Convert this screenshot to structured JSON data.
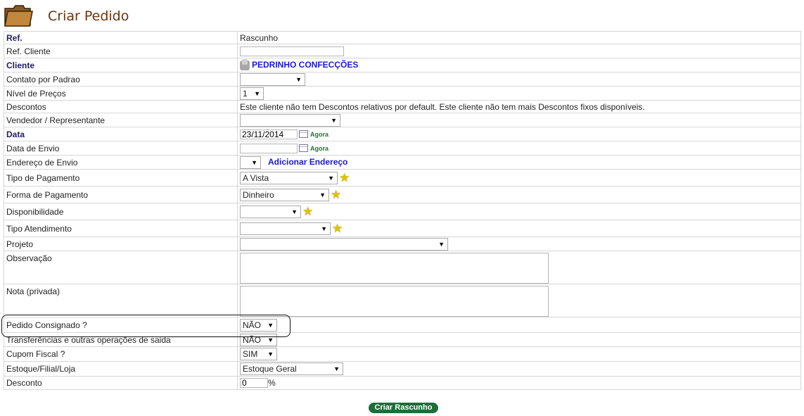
{
  "header": {
    "title": "Criar Pedido",
    "icon": "folder-icon"
  },
  "form": {
    "ref": {
      "label": "Ref.",
      "value": "Rascunho"
    },
    "ref_cliente": {
      "label": "Ref. Cliente",
      "value": ""
    },
    "cliente": {
      "label": "Cliente",
      "value": "PEDRINHO CONFECÇÕES"
    },
    "contato": {
      "label": "Contato por Padrao",
      "value": ""
    },
    "nivel_precos": {
      "label": "Nível de Preços",
      "value": "1"
    },
    "descontos": {
      "label": "Descontos",
      "value": "Este cliente não tem Descontos relativos por default. Este cliente não tem mais Descontos fixos disponíveis."
    },
    "vendedor": {
      "label": "Vendedor / Representante",
      "value": ""
    },
    "data": {
      "label": "Data",
      "value": "23/11/2014",
      "now": "Agora"
    },
    "data_envio": {
      "label": "Data de Envio",
      "value": "",
      "now": "Agora"
    },
    "endereco_envio": {
      "label": "Endereço de Envio",
      "value": "",
      "add_link": "Adicionar Endereço"
    },
    "tipo_pagamento": {
      "label": "Tipo de Pagamento",
      "value": "A Vista"
    },
    "forma_pagamento": {
      "label": "Forma de Pagamento",
      "value": "Dinheiro"
    },
    "disponibilidade": {
      "label": "Disponibilidade",
      "value": ""
    },
    "tipo_atendimento": {
      "label": "Tipo Atendimento",
      "value": ""
    },
    "projeto": {
      "label": "Projeto",
      "value": ""
    },
    "observacao": {
      "label": "Observação",
      "value": ""
    },
    "nota_privada": {
      "label": "Nota (privada)",
      "value": ""
    },
    "pedido_consignado": {
      "label": "Pedido Consignado ?",
      "value": "NÃO"
    },
    "transferencias": {
      "label": "Transferências e outras operações de saida",
      "value": "NÃO"
    },
    "cupom_fiscal": {
      "label": "Cupom Fiscal ?",
      "value": "SIM"
    },
    "estoque": {
      "label": "Estoque/Filial/Loja",
      "value": "Estoque Geral"
    },
    "desconto": {
      "label": "Desconto",
      "value": "0",
      "unit": "%"
    }
  },
  "submit": {
    "label": "Criar Rascunho"
  },
  "colors": {
    "title": "#6b3410",
    "link": "#1a1ad6",
    "button": "#1e6d3a",
    "star": "#e3c200"
  }
}
